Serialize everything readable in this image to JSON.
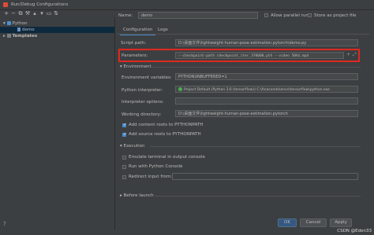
{
  "window": {
    "title": "Run/Debug Configurations"
  },
  "tree": {
    "items": [
      {
        "label": "Python"
      },
      {
        "label": "demo"
      },
      {
        "label": "Templates"
      }
    ]
  },
  "form": {
    "name_label": "Name:",
    "name_value": "demo",
    "allow_parallel_label": "Allow parallel run",
    "store_label": "Store as project file",
    "tabs": [
      "Configuration",
      "Logs"
    ],
    "script_label": "Script path:",
    "script_value": "D:\\桌面文件\\lightweight-human-pose-estimation.pytorch\\demo.py",
    "params_label": "Parameters:",
    "params_value": "--checkpoint-path checkpoint_iter_370000.pth --video 50Hz.mp4",
    "env_section": "Environment",
    "env_vars_label": "Environment variables:",
    "env_vars_value": "PYTHONUNBUFFERED=1",
    "interpreter_label": "Python interpreter:",
    "interpreter_value": "Project Default (Python 3.6 (tensorflow)) C:\\Anaconda\\envs\\tensorflow\\python.exe",
    "interp_options_label": "Interpreter options:",
    "workdir_label": "Working directory:",
    "workdir_value": "D:\\桌面文件\\lightweight-human-pose-estimation.pytorch",
    "add_content_label": "Add content roots to PYTHONPATH",
    "add_source_label": "Add source roots to PYTHONPATH",
    "exec_section": "Execution",
    "emulate_label": "Emulate terminal in output console",
    "run_console_label": "Run with Python Console",
    "redirect_label": "Redirect input from:",
    "before_launch_label": "Before launch"
  },
  "buttons": {
    "ok": "OK",
    "cancel": "Cancel",
    "apply": "Apply"
  },
  "watermark": "CSDN @Eden33"
}
